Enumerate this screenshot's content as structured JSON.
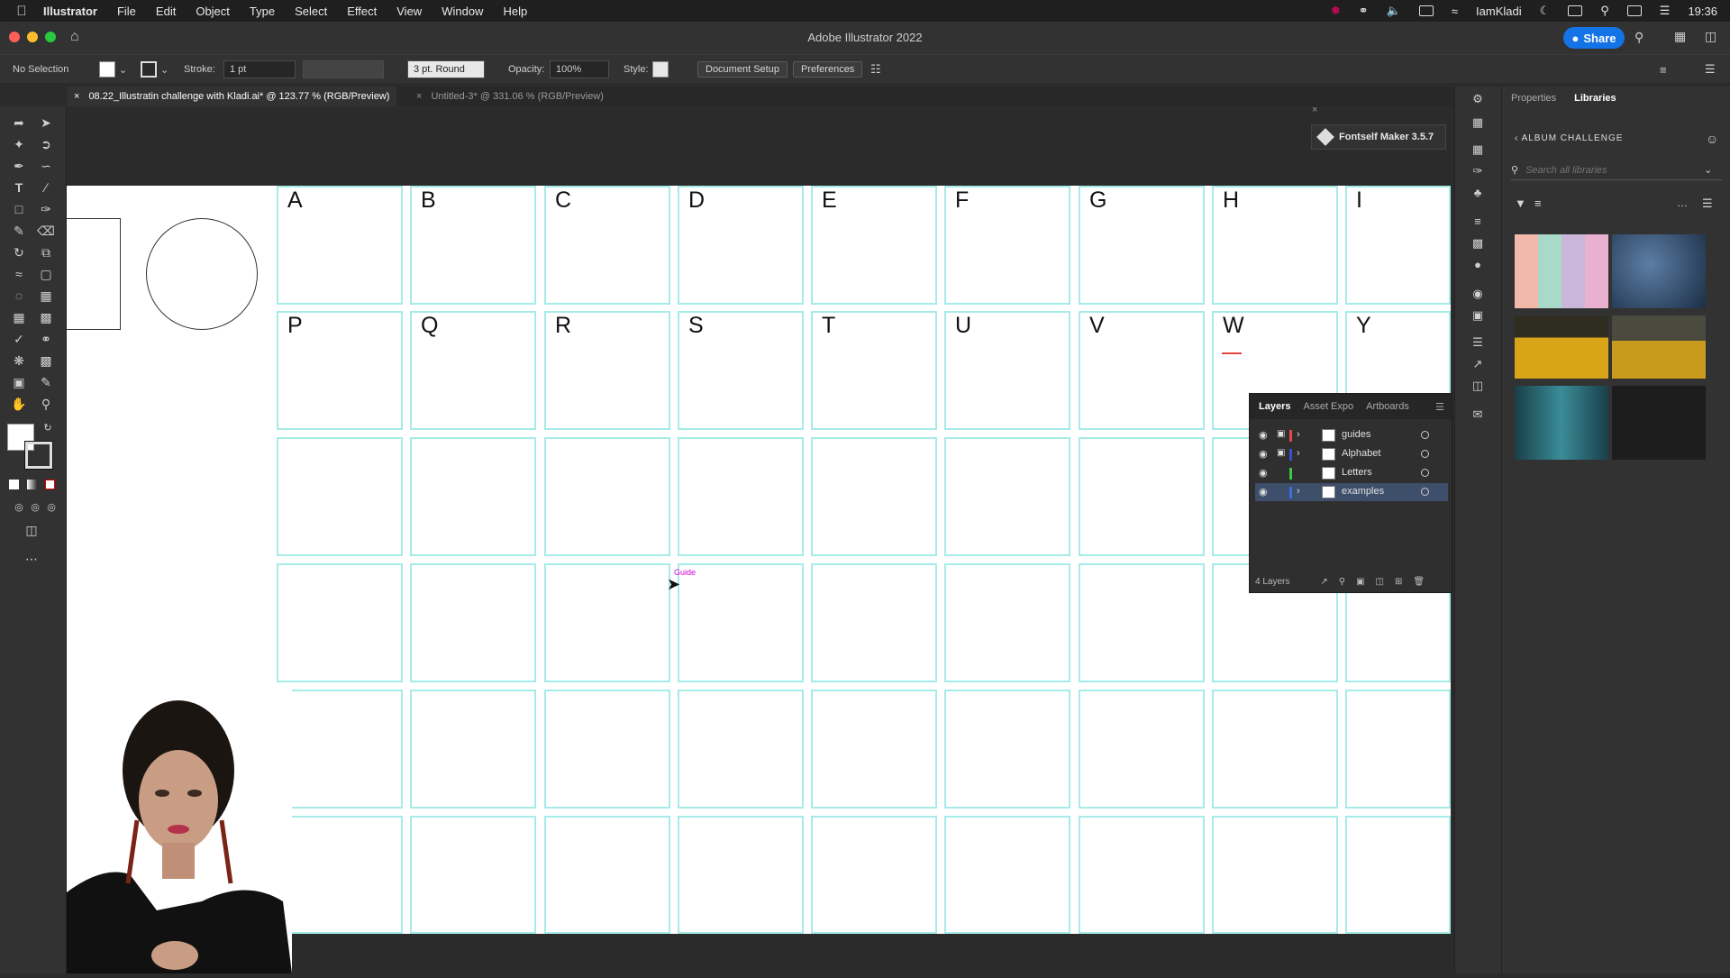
{
  "menubar": {
    "app_name": "Illustrator",
    "items": [
      "File",
      "Edit",
      "Object",
      "Type",
      "Select",
      "Effect",
      "View",
      "Window",
      "Help"
    ],
    "user": "IamKladi",
    "time": "19:36"
  },
  "titlebar": {
    "title": "Adobe Illustrator 2022",
    "share_label": "Share"
  },
  "controlbar": {
    "selection": "No Selection",
    "stroke_label": "Stroke:",
    "stroke_value": "1 pt",
    "brush_value": "3 pt. Round",
    "opacity_label": "Opacity:",
    "opacity_value": "100%",
    "style_label": "Style:",
    "document_setup": "Document Setup",
    "preferences": "Preferences"
  },
  "tabs": [
    {
      "label": "08.22_Illustratin challenge with Kladi.ai* @ 123.77 % (RGB/Preview)",
      "active": true
    },
    {
      "label": "Untitled-3* @ 331.06 % (RGB/Preview)",
      "active": false
    }
  ],
  "fontself": {
    "label": "Fontself Maker 3.5.7"
  },
  "canvas": {
    "row1_letters": [
      "A",
      "B",
      "C",
      "D",
      "E",
      "F",
      "G",
      "H",
      "I"
    ],
    "row2_letters": [
      "P",
      "Q",
      "R",
      "S",
      "T",
      "U",
      "V",
      "W",
      "Y"
    ],
    "guide_label": "Guide"
  },
  "layers_panel": {
    "tabs": [
      "Layers",
      "Asset Expo",
      "Artboards"
    ],
    "layers": [
      {
        "name": "guides",
        "color": "#e84545"
      },
      {
        "name": "Alphabet",
        "color": "#3b4cd6"
      },
      {
        "name": "Letters",
        "color": "#3fc93f"
      },
      {
        "name": "examples",
        "color": "#3b6fe0"
      }
    ],
    "count_label": "4 Layers"
  },
  "libraries": {
    "tabs": [
      "Properties",
      "Libraries"
    ],
    "library_name": "ALBUM CHALLENGE",
    "search_placeholder": "Search all libraries"
  },
  "colors": {
    "guide_cyan": "#a5ece9",
    "share_blue": "#1473e6",
    "selected_row": "#3d4f6a"
  }
}
